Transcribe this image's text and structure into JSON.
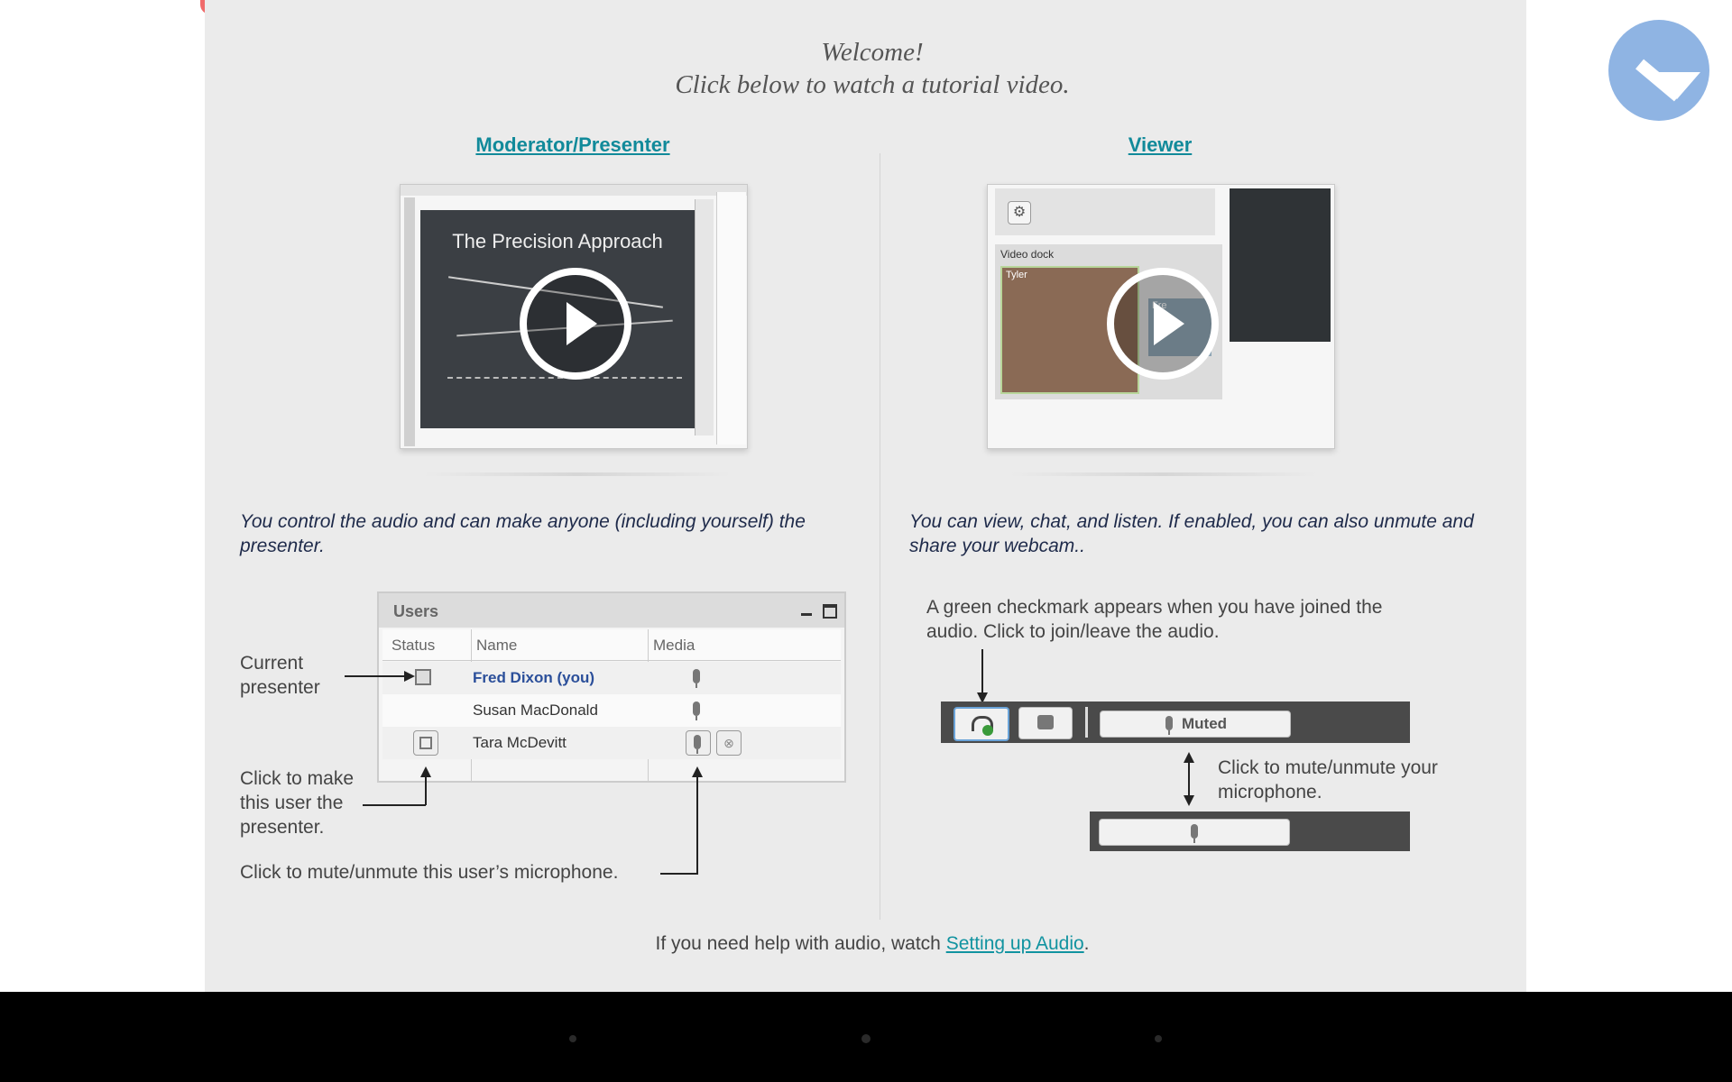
{
  "intro": {
    "line1": "Welcome!",
    "line2": "Click below to watch a tutorial video."
  },
  "moderator": {
    "heading": "Moderator/Presenter",
    "video_title": "The Precision Approach",
    "description": "You control the audio and can make anyone (including yourself) the presenter.",
    "users_panel": {
      "title": "Users",
      "columns": [
        "Status",
        "Name",
        "Media"
      ],
      "rows": [
        {
          "name": "Fred Dixon (you)"
        },
        {
          "name": "Susan MacDonald"
        },
        {
          "name": "Tara McDevitt"
        }
      ]
    },
    "callouts": {
      "current_presenter": "Current presenter",
      "make_presenter": "Click to make this user the presenter.",
      "mute_user": "Click to mute/unmute this user’s microphone."
    }
  },
  "viewer": {
    "heading": "Viewer",
    "video_labels": {
      "settings_dock": "",
      "video_dock": "Video dock",
      "user1": "Tyler",
      "user2": "Fre"
    },
    "description": "You can view, chat, and listen.  If enabled, you can also unmute and share your webcam..",
    "callouts": {
      "checkmark": "A green checkmark appears when you have joined the audio.  Click to join/leave the audio.",
      "mute_mic": "Click to mute/unmute your microphone."
    },
    "toolbar": {
      "muted_label": "Muted"
    }
  },
  "footer": {
    "prefix": "If you need help with audio, watch ",
    "link": "Setting up Audio",
    "suffix": "."
  },
  "colors": {
    "accent": "#118a9a",
    "page_bg": "#ebebeb",
    "badge": "#8fb4e3"
  },
  "icons": [
    "close-button-icon",
    "logo-badge-icon",
    "play-icon",
    "gear-icon",
    "headset-icon",
    "webcam-icon",
    "microphone-icon",
    "presenter-icon",
    "minimize-icon",
    "maximize-icon"
  ]
}
